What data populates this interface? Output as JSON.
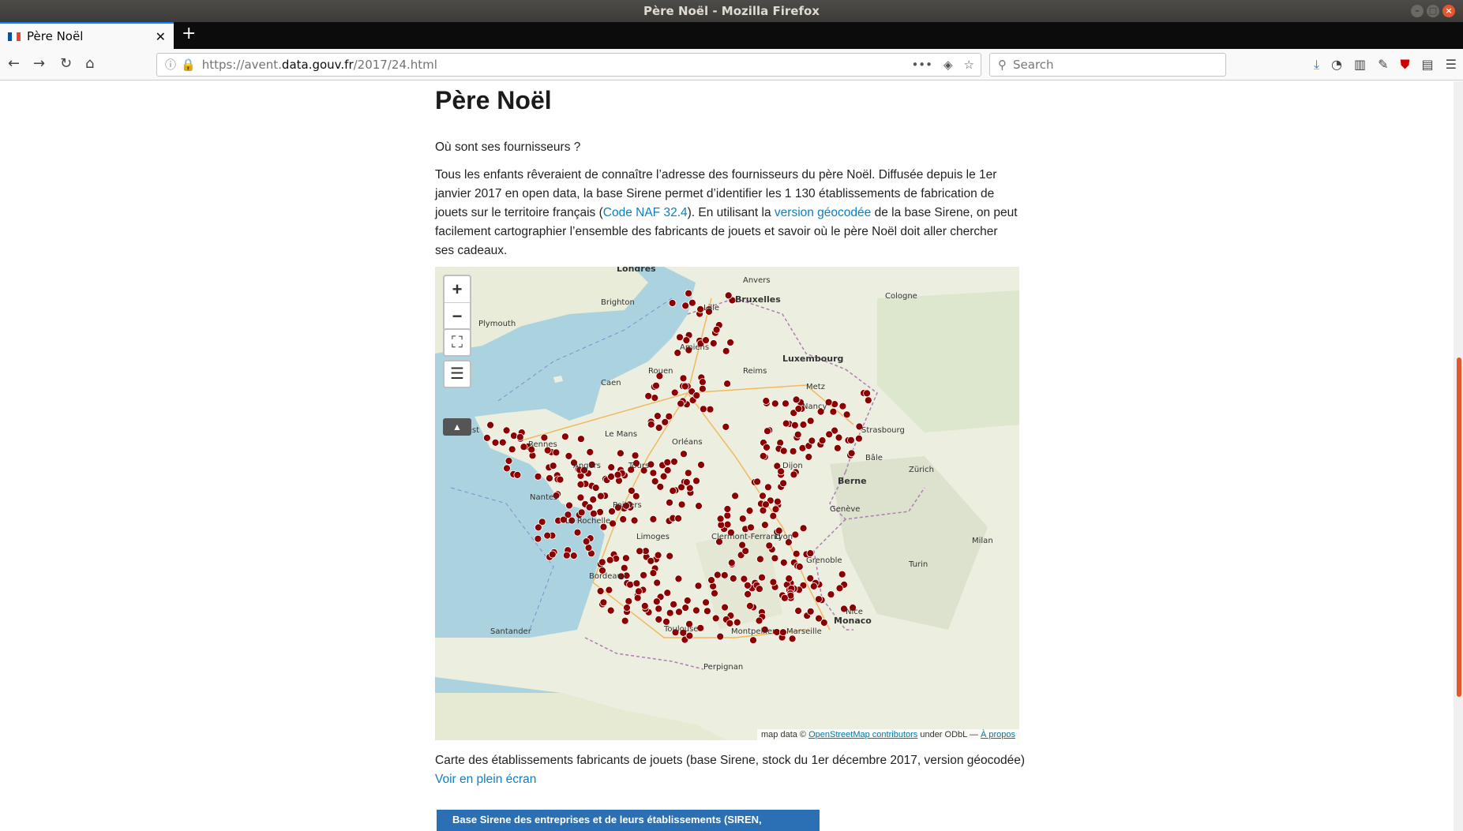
{
  "window": {
    "title": "Père Noël - Mozilla Firefox"
  },
  "tab": {
    "title": "Père Noël",
    "flag_colors": [
      "#0055a4",
      "#ffffff",
      "#ef4135"
    ]
  },
  "navbar": {
    "url_scheme": "https://avent.",
    "url_host": "data.gouv.fr",
    "url_path": "/2017/24.html",
    "search_placeholder": "Search"
  },
  "article": {
    "heading": "Père Noël",
    "subtitle": "Où sont ses fournisseurs ?",
    "para_1": "Tous les enfants rêveraient de connaître l’adresse des fournisseurs du père Noël. Diffusée depuis le 1er janvier 2017 en open data, la base Sirene permet d’identifier les 1 130 établissements de fabrication de jouets sur le territoire français (",
    "link_naf": "Code NAF 32.4",
    "para_2": "). En utilisant la ",
    "link_geocoded": "version géocodée",
    "para_3": " de la base Sirene, on peut facilement cartographier l’ensemble des fabricants de jouets et savoir où le père Noël doit aller chercher ses cadeaux.",
    "caption": "Carte des établissements fabricants de jouets (base Sirene, stock du 1er décembre 2017, version géocodée)",
    "fullscreen_link": "Voir en plein écran",
    "sirene_button": "Base Sirene des entreprises et de leurs établissements (SIREN,"
  },
  "map": {
    "zoom_in": "+",
    "zoom_out": "−",
    "attribution_prefix": "map data © ",
    "attribution_link": "OpenStreetMap contributors",
    "attribution_mid": " under ODbL — ",
    "attribution_about": "À propos",
    "marker_color": "#8b0000",
    "city_labels": [
      "Londres",
      "Bruxelles",
      "Luxembourg",
      "Berne",
      "Monaco",
      "Rennes",
      "Nantes",
      "Bordeaux",
      "Toulouse",
      "Lyon",
      "Marseille",
      "Strasbourg",
      "Lille",
      "Orléans",
      "Limoges",
      "Dijon",
      "Grenoble",
      "Nice",
      "Montpellier",
      "Brest",
      "Caen",
      "Rouen",
      "Amiens",
      "Reims",
      "Metz",
      "Nancy",
      "Clermont-Ferrand",
      "Poitiers",
      "Tours",
      "Le Mans",
      "Angers",
      "La Rochelle",
      "Perpignan",
      "Santander",
      "Plymouth",
      "Brighton",
      "Cologne",
      "Turin",
      "Milan",
      "Genève",
      "Zürich",
      "Bâle",
      "Anvers"
    ]
  }
}
